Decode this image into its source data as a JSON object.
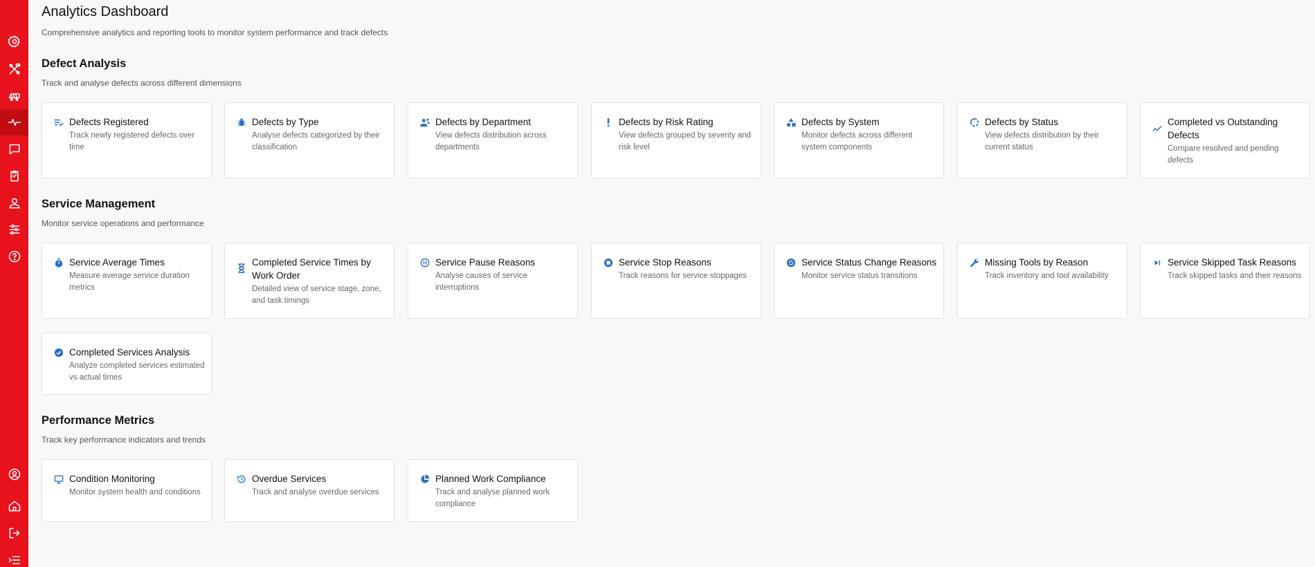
{
  "sidebar": {
    "icons": [
      "settings-gear-icon",
      "tools-icon",
      "train-icon",
      "analytics-pulse-icon",
      "chat-icon",
      "clipboard-icon",
      "user-icon",
      "sliders-icon",
      "help-icon",
      "profile-icon",
      "home-icon",
      "logout-icon",
      "menu-collapse-icon"
    ],
    "active": "analytics-pulse-icon",
    "color": "#e8121c"
  },
  "page": {
    "title": "Analytics Dashboard",
    "subtitle": "Comprehensive analytics and reporting tools to monitor system performance and track defects"
  },
  "sections": [
    {
      "title": "Defect Analysis",
      "subtitle": "Track and analyse defects across different dimensions",
      "cards": [
        {
          "title": "Defects Registered",
          "description": "Track newly registered defects over time",
          "icon": "list-check-icon"
        },
        {
          "title": "Defects by Type",
          "description": "Analyse defects categorized by their classification",
          "icon": "bug-icon"
        },
        {
          "title": "Defects by Department",
          "description": "View defects distribution across departments",
          "icon": "people-icon"
        },
        {
          "title": "Defects by Risk Rating",
          "description": "View defects grouped by severity and risk level",
          "icon": "exclamation-icon"
        },
        {
          "title": "Defects by System",
          "description": "Monitor defects across different system components",
          "icon": "shapes-icon"
        },
        {
          "title": "Defects by Status",
          "description": "View defects distribution by their current status",
          "icon": "status-ring-icon"
        },
        {
          "title": "Completed vs Outstanding Defects",
          "description": "Compare resolved and pending defects",
          "icon": "trend-line-icon"
        }
      ]
    },
    {
      "title": "Service Management",
      "subtitle": "Monitor service operations and performance",
      "cards": [
        {
          "title": "Service Average Times",
          "description": "Measure average service duration metrics",
          "icon": "stopwatch-icon"
        },
        {
          "title": "Completed Service Times by Work Order",
          "description": "Detailed view of service stage, zone, and task timings",
          "icon": "hourglass-icon"
        },
        {
          "title": "Service Pause Reasons",
          "description": "Analyse causes of service interruptions",
          "icon": "pause-circle-icon"
        },
        {
          "title": "Service Stop Reasons",
          "description": "Track reasons for service stoppages",
          "icon": "stop-circle-icon"
        },
        {
          "title": "Service Status Change Reasons",
          "description": "Monitor service status transitions",
          "icon": "change-circle-icon"
        },
        {
          "title": "Missing Tools by Reason",
          "description": "Track inventory and tool availability",
          "icon": "wrench-icon"
        },
        {
          "title": "Service Skipped Task Reasons",
          "description": "Track skipped tasks and their reasons",
          "icon": "skip-next-icon"
        },
        {
          "title": "Completed Services Analysis",
          "description": "Analyze completed services estimated vs actual times",
          "icon": "check-circle-icon"
        }
      ]
    },
    {
      "title": "Performance Metrics",
      "subtitle": "Track key performance indicators and trends",
      "cards": [
        {
          "title": "Condition Monitoring",
          "description": "Monitor system health and conditions",
          "icon": "monitor-icon"
        },
        {
          "title": "Overdue Services",
          "description": "Track and analyse overdue services",
          "icon": "history-icon"
        },
        {
          "title": "Planned Work Compliance",
          "description": "Track and analyse planned work compliance",
          "icon": "pie-chart-icon"
        }
      ]
    }
  ],
  "accent_color": "#2f6fc4"
}
